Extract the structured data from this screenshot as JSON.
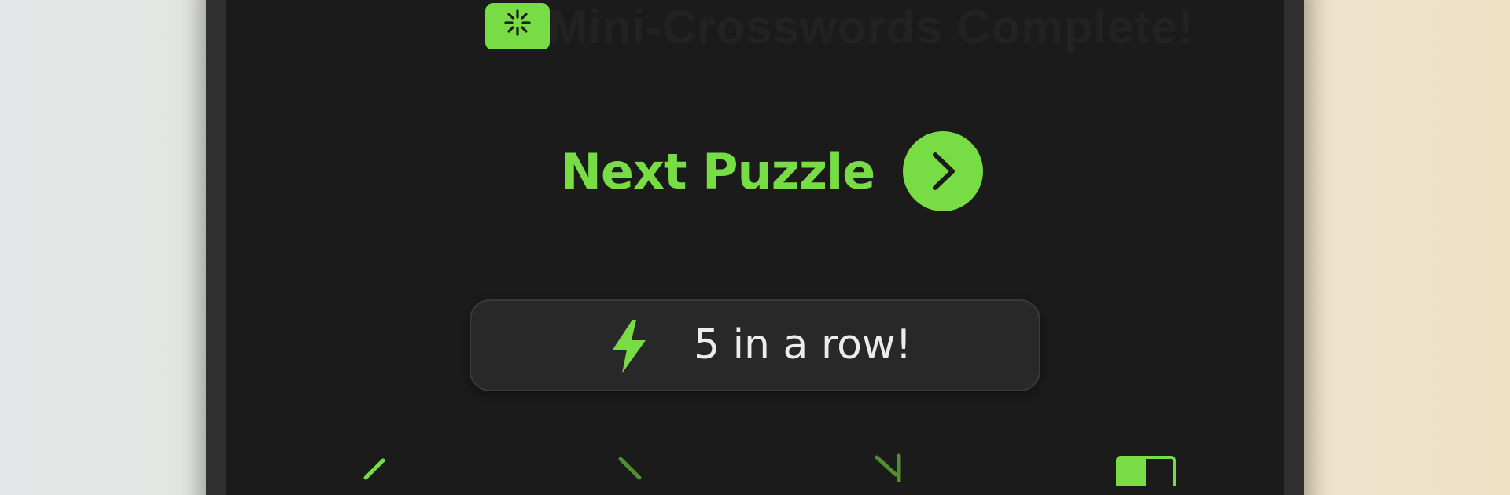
{
  "header": {
    "faded_title": "Mini-Crosswords Complete!"
  },
  "next_puzzle": {
    "label": "Next Puzzle"
  },
  "streak": {
    "text": "5 in a row!"
  },
  "colors": {
    "accent": "#78dc45",
    "screen_bg": "#1b1b1b",
    "pill_bg": "#282828",
    "text_light": "#ececec"
  },
  "icons": {
    "header": "chat-bubble-sparkle-icon",
    "next": "chevron-right-icon",
    "streak": "lightning-bolt-icon",
    "nav": [
      "undo-arrow-icon",
      "chevron-right-icon",
      "expand-arrow-icon",
      "layout-split-icon"
    ]
  }
}
